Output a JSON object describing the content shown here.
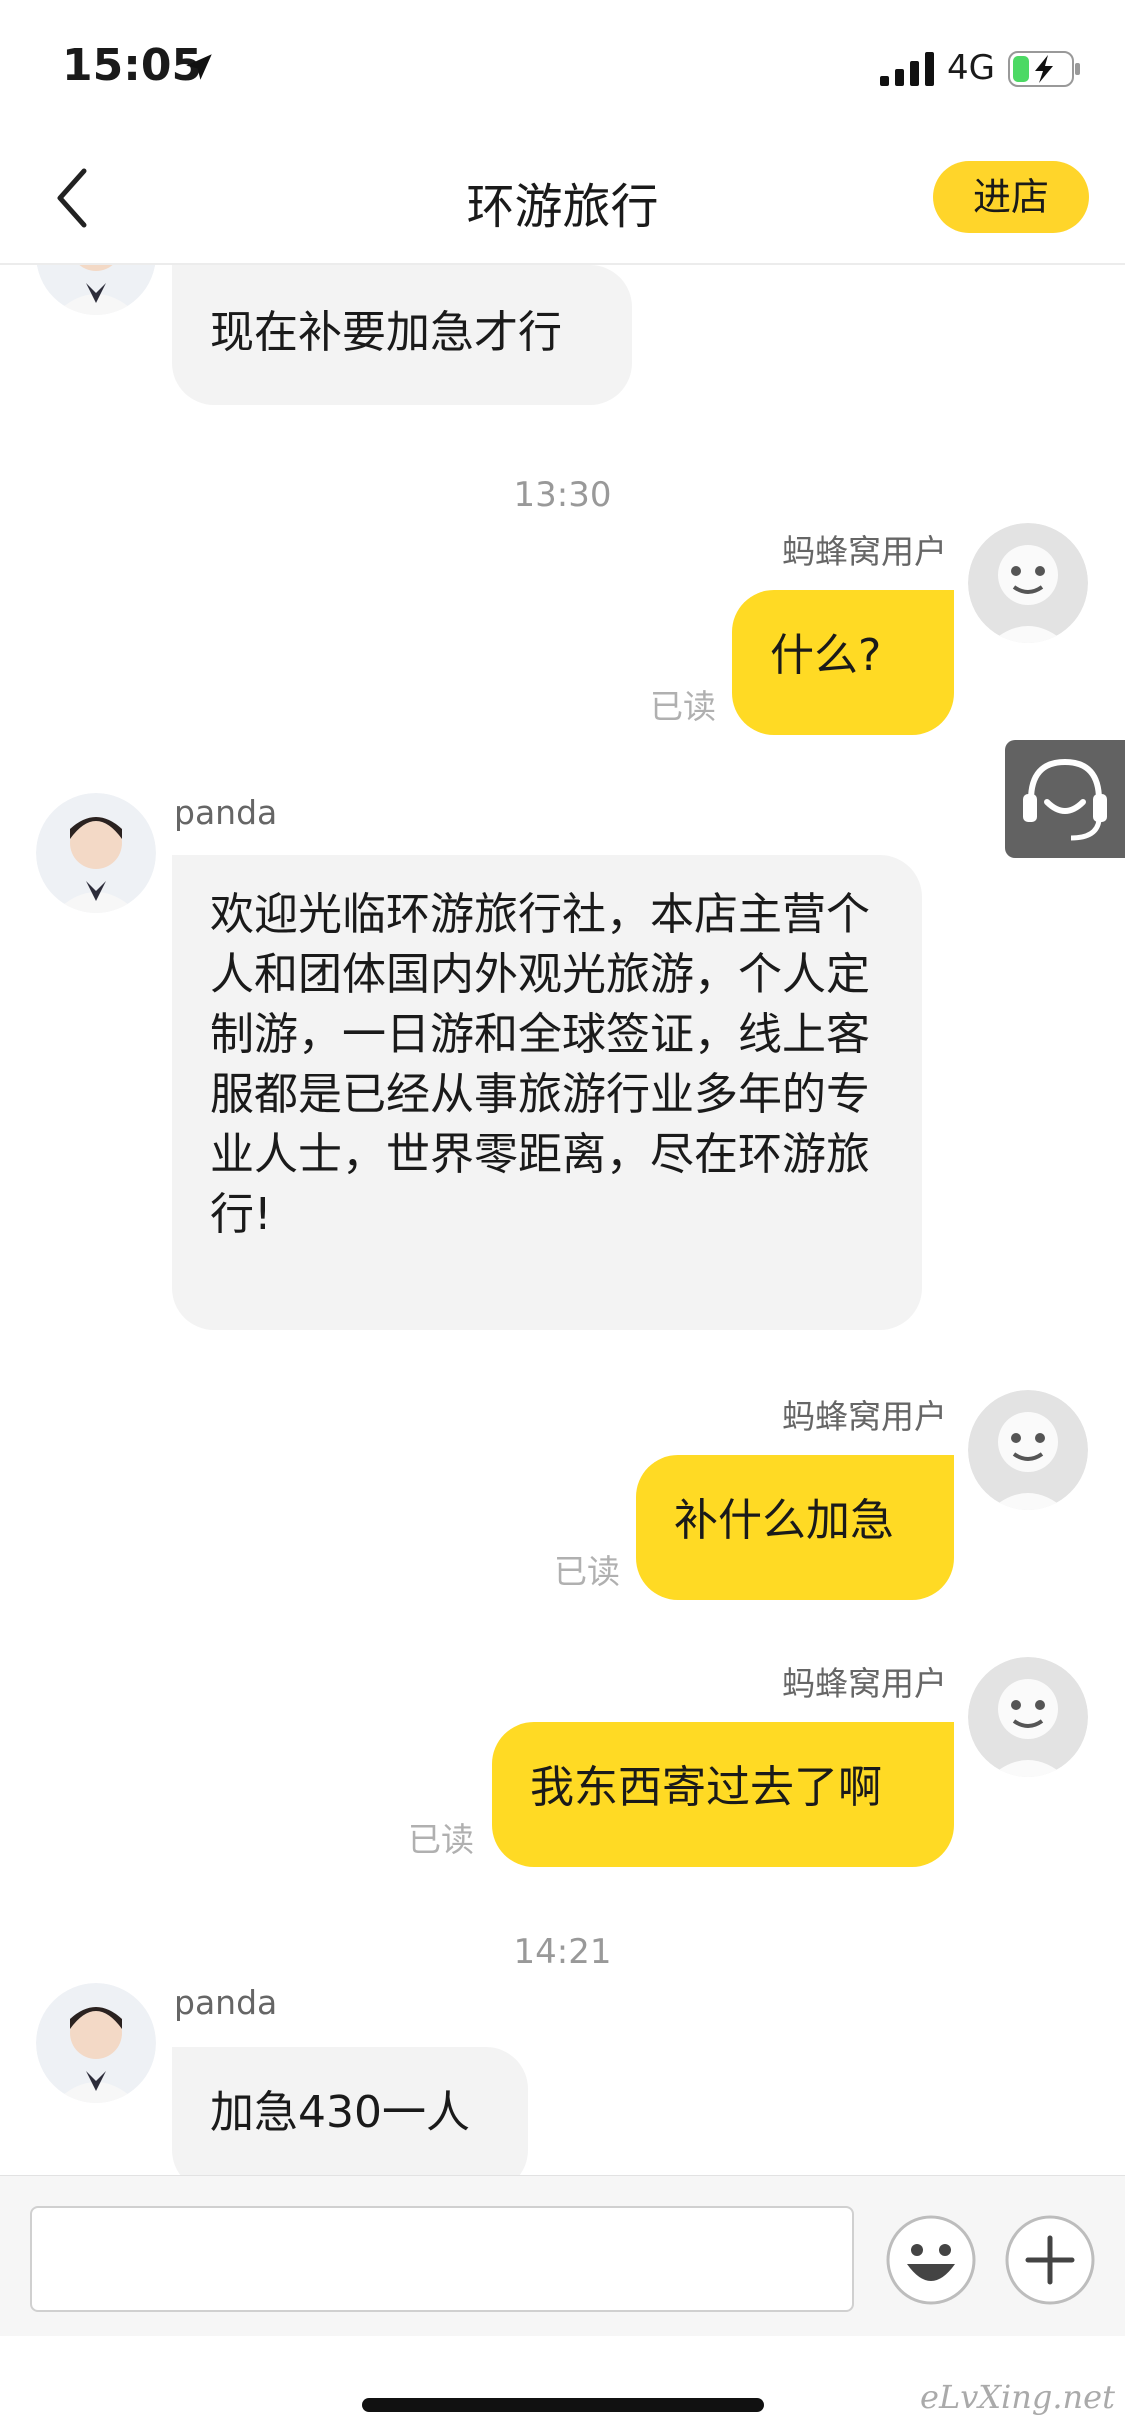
{
  "status_bar": {
    "time": "15:05",
    "network": "4G"
  },
  "nav": {
    "title": "环游旅行",
    "enter_label": "进店"
  },
  "messages": [
    {
      "text": "现在补要加急才行"
    },
    {
      "timestamp": "13:30"
    },
    {
      "sender": "蚂蜂窝用户",
      "text": "什么?",
      "read": "已读"
    },
    {
      "sender": "panda",
      "text": "欢迎光临环游旅行社，本店主营个人和团体国内外观光旅游，个人定制游，一日游和全球签证，线上客服都是已经从事旅游行业多年的专业人士，世界零距离，尽在环游旅行!"
    },
    {
      "sender": "蚂蜂窝用户",
      "text": "补什么加急",
      "read": "已读"
    },
    {
      "sender": "蚂蜂窝用户",
      "text": "我东西寄过去了啊",
      "read": "已读"
    },
    {
      "timestamp": "14:21"
    },
    {
      "sender": "panda",
      "text": "加急430一人"
    }
  ],
  "input": {
    "placeholder": ""
  },
  "watermark": "eLvXing.net",
  "colors": {
    "accent": "#ffda24",
    "incoming_bubble": "#f3f3f3"
  }
}
